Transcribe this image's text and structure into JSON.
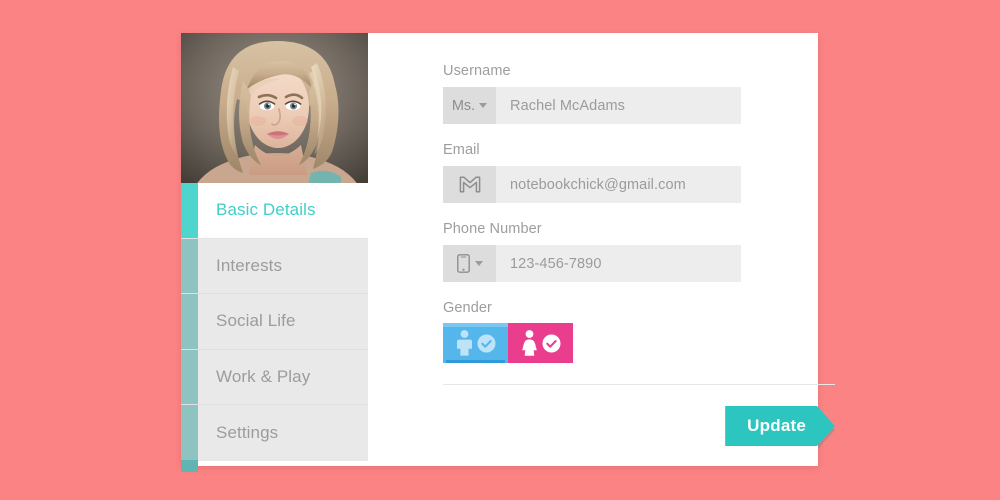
{
  "theme": {
    "page_background": "#fc8384",
    "card_background": "#ffffff",
    "accent_teal": "#2cc5c0",
    "accent_teal_bright": "#4ed6ce",
    "accent_teal_muted": "#8fc3c1",
    "male_blue": "#55b6ec",
    "female_pink": "#ea3d8e",
    "input_background": "#ededed",
    "prefix_background": "#dddddd",
    "nav_inactive_background": "#e9e9e9",
    "nav_active_text": "#3fcfc8",
    "label_gray": "#9d9d9d"
  },
  "profile": {
    "photo_alt": "profile-photo"
  },
  "sidebar": {
    "items": [
      {
        "label": "Basic Details",
        "active": true
      },
      {
        "label": "Interests",
        "active": false
      },
      {
        "label": "Social Life",
        "active": false
      },
      {
        "label": "Work & Play",
        "active": false
      },
      {
        "label": "Settings",
        "active": false
      }
    ]
  },
  "form": {
    "username": {
      "label": "Username",
      "prefix_value": "Ms.",
      "prefix_icon": "chevron-down-icon",
      "value": "Rachel McAdams"
    },
    "email": {
      "label": "Email",
      "prefix_icon": "gmail-icon",
      "value": "notebookchick@gmail.com"
    },
    "phone": {
      "label": "Phone Number",
      "prefix_icon": "smartphone-icon",
      "value": "123-456-7890"
    },
    "gender": {
      "label": "Gender",
      "options": [
        {
          "name": "male",
          "icon": "male-figure-icon",
          "check_icon": "check-circle-icon",
          "selected": false
        },
        {
          "name": "female",
          "icon": "female-figure-icon",
          "check_icon": "check-circle-icon",
          "selected": true
        }
      ]
    },
    "submit": {
      "label": "Update"
    }
  }
}
